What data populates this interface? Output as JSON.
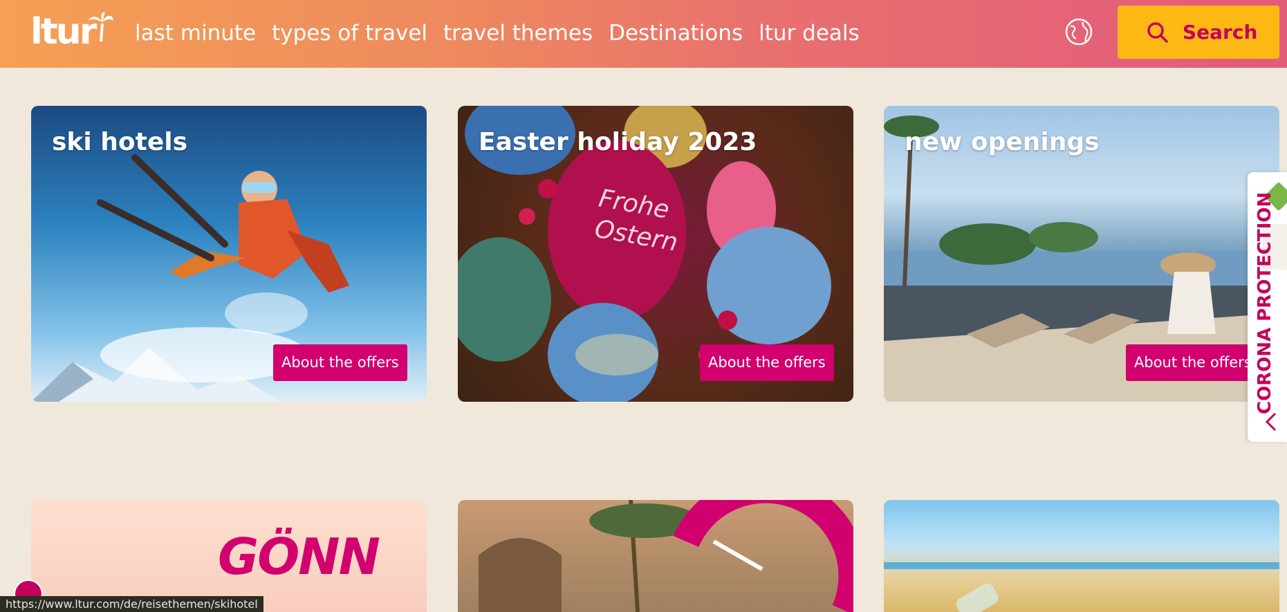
{
  "header": {
    "logo": "ltur",
    "nav": [
      "last minute",
      "types of travel",
      "travel themes",
      "Destinations",
      "ltur deals"
    ],
    "search_label": "Search"
  },
  "cards": [
    {
      "title": "ski hotels",
      "button": "About the offers"
    },
    {
      "title": "Easter holiday 2023",
      "button": "About the offers"
    },
    {
      "title": "new openings",
      "button": "About the offers"
    }
  ],
  "promo": {
    "text": "GÖNN"
  },
  "side_tab": {
    "label": "CORONA PROTECTION"
  },
  "status_bar": {
    "url": "https://www.ltur.com/de/reisethemen/skihotel"
  },
  "colors": {
    "brand_pink": "#d2006e",
    "search_yellow": "#fdb813",
    "background": "#f1e8dc"
  },
  "icons": [
    "palm-tree-icon",
    "globe-icon",
    "search-icon",
    "chevron-left-icon",
    "cookie-icon"
  ]
}
